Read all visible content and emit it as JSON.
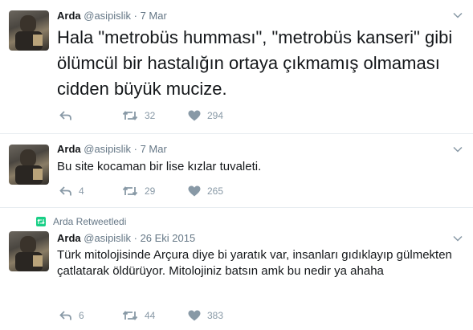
{
  "tweets": [
    {
      "name": "Arda",
      "handle": "@asipislik",
      "separator": "·",
      "time": "7 Mar",
      "text": "Hala \"metrobüs humması\", \"metrobüs kanseri\" gibi ölümcül bir hastalığın ortaya çıkmamış olmaması cidden büyük mucize.",
      "replies": "",
      "retweets": "32",
      "likes": "294"
    },
    {
      "name": "Arda",
      "handle": "@asipislik",
      "separator": "·",
      "time": "7 Mar",
      "text": "Bu site kocaman bir lise kızlar tuvaleti.",
      "replies": "4",
      "retweets": "29",
      "likes": "265"
    },
    {
      "retweeted_by": "Arda Retweetledi",
      "name": "Arda",
      "handle": "@asipislik",
      "separator": "·",
      "time": "26 Eki 2015",
      "text": "Türk mitolojisinde Arçura diye bi yaratık var, insanları gıdıklayıp gülmekten çatlatarak öldürüyor. Mitolojiniz batsın amk bu nedir ya ahaha",
      "replies": "6",
      "retweets": "44",
      "likes": "383"
    }
  ],
  "icons": {
    "reply": "reply-icon",
    "retweet": "retweet-icon",
    "like": "heart-icon",
    "more": "chevron-down-icon"
  },
  "colors": {
    "retweet_badge": "#19cf86",
    "muted": "#8899a6",
    "divider": "#e6ecf0"
  }
}
